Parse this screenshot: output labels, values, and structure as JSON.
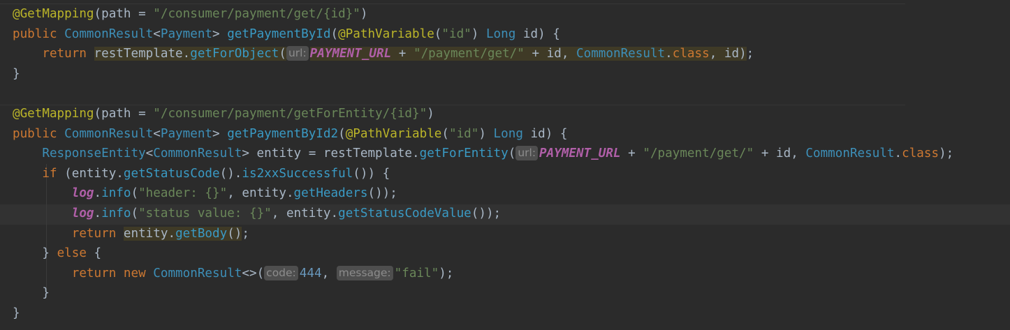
{
  "editor": {
    "lines": [
      [
        {
          "t": "@GetMapping",
          "c": "ann"
        },
        {
          "t": "(path = "
        },
        {
          "t": "\"/consumer/payment/get/{id}\"",
          "c": "str"
        },
        {
          "t": ")"
        }
      ],
      [
        {
          "t": "public ",
          "c": "kw"
        },
        {
          "t": "CommonResult",
          "c": "cls"
        },
        {
          "t": "<"
        },
        {
          "t": "Payment",
          "c": "cls"
        },
        {
          "t": "> "
        },
        {
          "t": "getPaymentById",
          "c": "mth"
        },
        {
          "t": "("
        },
        {
          "t": "@PathVariable",
          "c": "ann"
        },
        {
          "t": "("
        },
        {
          "t": "\"id\"",
          "c": "str"
        },
        {
          "t": ") "
        },
        {
          "t": "Long",
          "c": "cls"
        },
        {
          "t": " id) {"
        }
      ],
      [
        {
          "t": "    "
        },
        {
          "t": "return ",
          "c": "kw"
        },
        {
          "t": "restTemplate",
          "c": "hl"
        },
        {
          "t": ".",
          "c": "hl"
        },
        {
          "t": "getForObject",
          "c": "mth hl"
        },
        {
          "t": "(",
          "c": "hl"
        },
        {
          "t": "url:",
          "c": "hint"
        },
        {
          "t": "PAYMENT_URL",
          "c": "const hl"
        },
        {
          "t": " + ",
          "c": "hl"
        },
        {
          "t": "\"/payment/get/\"",
          "c": "str hl"
        },
        {
          "t": " + id, ",
          "c": "hl"
        },
        {
          "t": "CommonResult",
          "c": "cls hl"
        },
        {
          "t": ".",
          "c": "hl"
        },
        {
          "t": "class",
          "c": "kw hl"
        },
        {
          "t": ", id)",
          "c": "hl"
        },
        {
          "t": ";"
        }
      ],
      [
        {
          "t": "}"
        }
      ],
      [],
      [
        {
          "t": "@GetMapping",
          "c": "ann"
        },
        {
          "t": "(path = "
        },
        {
          "t": "\"/consumer/payment/getForEntity/{id}\"",
          "c": "str"
        },
        {
          "t": ")"
        }
      ],
      [
        {
          "t": "public ",
          "c": "kw"
        },
        {
          "t": "CommonResult",
          "c": "cls"
        },
        {
          "t": "<"
        },
        {
          "t": "Payment",
          "c": "cls"
        },
        {
          "t": "> "
        },
        {
          "t": "getPaymentById2",
          "c": "mth"
        },
        {
          "t": "("
        },
        {
          "t": "@PathVariable",
          "c": "ann"
        },
        {
          "t": "("
        },
        {
          "t": "\"id\"",
          "c": "str"
        },
        {
          "t": ") "
        },
        {
          "t": "Long",
          "c": "cls"
        },
        {
          "t": " id) {"
        }
      ],
      [
        {
          "t": "    "
        },
        {
          "t": "ResponseEntity",
          "c": "cls"
        },
        {
          "t": "<"
        },
        {
          "t": "CommonResult",
          "c": "cls"
        },
        {
          "t": "> entity = "
        },
        {
          "t": "restTemplate."
        },
        {
          "t": "getForEntity",
          "c": "mth"
        },
        {
          "t": "("
        },
        {
          "t": "url:",
          "c": "hint"
        },
        {
          "t": "PAYMENT_URL",
          "c": "const"
        },
        {
          "t": " + "
        },
        {
          "t": "\"/payment/get/\"",
          "c": "str"
        },
        {
          "t": " + id, "
        },
        {
          "t": "CommonResult",
          "c": "cls"
        },
        {
          "t": "."
        },
        {
          "t": "class",
          "c": "kw"
        },
        {
          "t": ");"
        }
      ],
      [
        {
          "t": "    "
        },
        {
          "t": "if",
          "c": "kw"
        },
        {
          "t": " (entity."
        },
        {
          "t": "getStatusCode",
          "c": "mth"
        },
        {
          "t": "()."
        },
        {
          "t": "is2xxSuccessful",
          "c": "mth"
        },
        {
          "t": "()) {"
        }
      ],
      [
        {
          "t": "        "
        },
        {
          "t": "log",
          "c": "logv"
        },
        {
          "t": "."
        },
        {
          "t": "info",
          "c": "mth"
        },
        {
          "t": "("
        },
        {
          "t": "\"header: {}\"",
          "c": "str"
        },
        {
          "t": ", entity."
        },
        {
          "t": "getHeaders",
          "c": "mth"
        },
        {
          "t": "());"
        }
      ],
      [
        {
          "t": "        "
        },
        {
          "t": "log",
          "c": "logv"
        },
        {
          "t": "."
        },
        {
          "t": "info",
          "c": "mth"
        },
        {
          "t": "("
        },
        {
          "t": "\"status value: {}\"",
          "c": "str"
        },
        {
          "t": ", entity."
        },
        {
          "t": "getStatusCodeValue",
          "c": "mth"
        },
        {
          "t": "());"
        }
      ],
      [
        {
          "t": "        "
        },
        {
          "t": "return ",
          "c": "kw"
        },
        {
          "t": "entity",
          "c": "hl"
        },
        {
          "t": ".",
          "c": "hl"
        },
        {
          "t": "getBody",
          "c": "mth hl"
        },
        {
          "t": "()",
          "c": "hl"
        },
        {
          "t": ";"
        }
      ],
      [
        {
          "t": "    } "
        },
        {
          "t": "else",
          "c": "kw"
        },
        {
          "t": " {"
        }
      ],
      [
        {
          "t": "        "
        },
        {
          "t": "return new ",
          "c": "kw"
        },
        {
          "t": "CommonResult",
          "c": "cls"
        },
        {
          "t": "<>("
        },
        {
          "t": "code:",
          "c": "hint"
        },
        {
          "t": "444",
          "c": "num"
        },
        {
          "t": ", "
        },
        {
          "t": "message:",
          "c": "hint"
        },
        {
          "t": "\"fail\"",
          "c": "str"
        },
        {
          "t": ");"
        }
      ],
      [
        {
          "t": "    }"
        }
      ],
      [
        {
          "t": "}"
        }
      ]
    ]
  }
}
